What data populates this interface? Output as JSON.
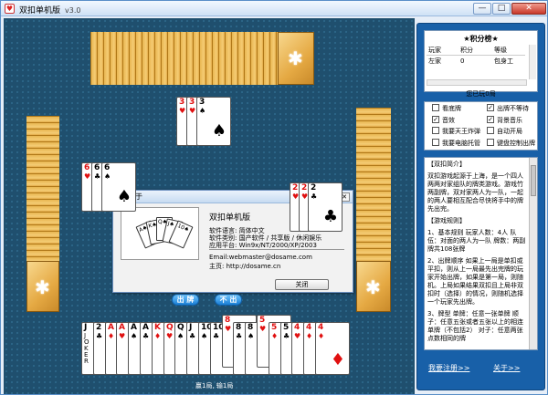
{
  "window": {
    "title": "双扣单机版",
    "version": "v3.0",
    "buttons": {
      "minimize": "—",
      "maximize": "□",
      "close": "✕"
    }
  },
  "colors": {
    "table": "#1f4f6e",
    "card_back": "#e9b651",
    "panel": "#1860a8",
    "action_button": "#1a7ed4"
  },
  "game": {
    "top_played": [
      {
        "rank": "3",
        "suit": "♥",
        "color": "red"
      },
      {
        "rank": "3",
        "suit": "♥",
        "color": "red"
      },
      {
        "rank": "3",
        "suit": "♠",
        "color": "blk"
      }
    ],
    "left_played": [
      {
        "rank": "6",
        "suit": "♥",
        "color": "red"
      },
      {
        "rank": "6",
        "suit": "♣",
        "color": "blk"
      },
      {
        "rank": "6",
        "suit": "♠",
        "color": "blk"
      }
    ],
    "right_played": [
      {
        "rank": "2",
        "suit": "♥",
        "color": "red"
      },
      {
        "rank": "2",
        "suit": "♥",
        "color": "red"
      },
      {
        "rank": "2",
        "suit": "♣",
        "color": "blk"
      }
    ],
    "hand": [
      {
        "rank": "J",
        "suit": "",
        "color": "blk",
        "joker": "JOKER"
      },
      {
        "rank": "2",
        "suit": "♣",
        "color": "blk"
      },
      {
        "rank": "A",
        "suit": "♦",
        "color": "red"
      },
      {
        "rank": "A",
        "suit": "♥",
        "color": "red"
      },
      {
        "rank": "A",
        "suit": "♠",
        "color": "blk"
      },
      {
        "rank": "A",
        "suit": "♣",
        "color": "blk"
      },
      {
        "rank": "K",
        "suit": "♦",
        "color": "red"
      },
      {
        "rank": "Q",
        "suit": "♥",
        "color": "red"
      },
      {
        "rank": "Q",
        "suit": "♠",
        "color": "blk"
      },
      {
        "rank": "J",
        "suit": "♣",
        "color": "blk"
      },
      {
        "rank": "10",
        "suit": "♠",
        "color": "blk"
      },
      {
        "rank": "10",
        "suit": "♣",
        "color": "blk"
      },
      {
        "rank": "8",
        "suit": "♥",
        "color": "red"
      },
      {
        "rank": "8",
        "suit": "♣",
        "color": "blk"
      },
      {
        "rank": "8",
        "suit": "♠",
        "color": "blk"
      },
      {
        "rank": "5",
        "suit": "♥",
        "color": "red"
      },
      {
        "rank": "5",
        "suit": "♦",
        "color": "red"
      },
      {
        "rank": "5",
        "suit": "♣",
        "color": "blk"
      },
      {
        "rank": "4",
        "suit": "♥",
        "color": "red"
      },
      {
        "rank": "4",
        "suit": "♦",
        "color": "red"
      },
      {
        "rank": "4",
        "suit": "♦",
        "color": "red"
      }
    ],
    "play_button": "出 牌",
    "pass_button": "不 出",
    "score_line": "赢1局, 输1局"
  },
  "about": {
    "title": "关于",
    "app_name": "双扣单机版",
    "lines": [
      "软件语言:  简体中文",
      "软件类别:  国产软件 / 共享版 / 休闲娱乐",
      "应用平台:  Win9x/NT/2000/XP/2003"
    ],
    "email": "Email:webmaster@dosame.com",
    "homepage": "主页:  http://dosame.cn",
    "close_button": "关闭",
    "image_cards": [
      "A",
      "K",
      "Q",
      "J",
      "10"
    ]
  },
  "ranking": {
    "title": "★积分榜★",
    "headers": [
      "玩家",
      "积分",
      "等级"
    ],
    "rows": [
      [
        "左家",
        "0",
        "包身工"
      ]
    ],
    "played": "您已玩0局"
  },
  "options": [
    {
      "label": "看底牌",
      "checked": false
    },
    {
      "label": "出牌不等待",
      "checked": true
    },
    {
      "label": "音效",
      "checked": true
    },
    {
      "label": "背景音乐",
      "checked": true
    },
    {
      "label": "我要天王炸弹",
      "checked": false
    },
    {
      "label": "自动开局",
      "checked": false
    },
    {
      "label": "我要电脑托管",
      "checked": false
    },
    {
      "label": "键盘控制出牌",
      "checked": false
    }
  ],
  "help": {
    "paragraphs": [
      "【双扣简介】",
      "双扣游戏起源于上海，是一个四人两两对家组队的牌类游戏。游戏竹两副牌，双对家两人为一队，一起的两人要相互配合尽快将手中的牌先出完。",
      "【游戏规则】",
      "1、基本规则 玩家人数：4人 队伍：对面的两人为一队 牌数：两副牌共108张牌",
      "2、出牌顺序 如果上一局是单扣或平扣，则从上一局最先出完牌的玩家开始出牌，如果是第一局，则随机。上局如果结果双扣且上局非双扣时（选择）的情况，则随机选择一个玩家先出牌。",
      "3、牌型 单牌：任意一张单牌 顺子：任意五张或者五张以上的相连单牌（不包括2） 对子：任意两张点数相同的牌"
    ]
  },
  "links": {
    "register": "我要注册>>",
    "about": "关于>>"
  }
}
